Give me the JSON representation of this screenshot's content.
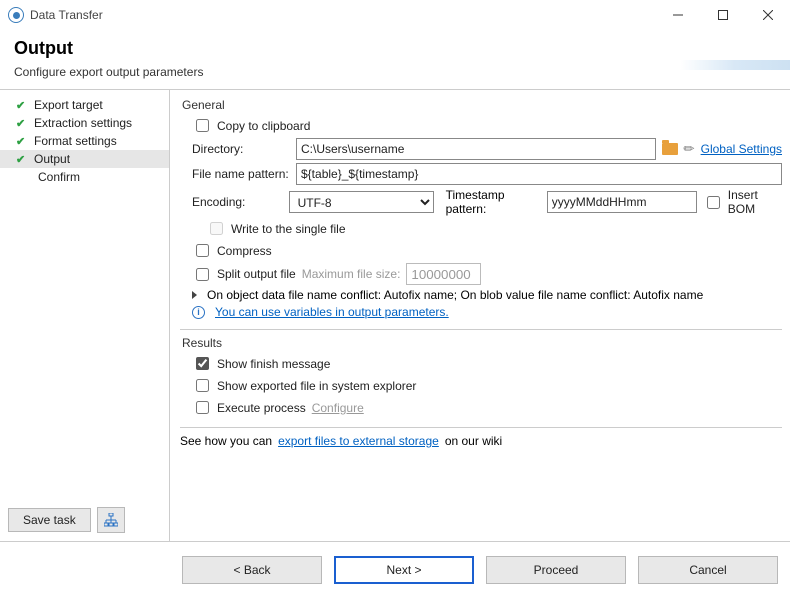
{
  "window": {
    "title": "Data Transfer"
  },
  "header": {
    "title": "Output",
    "subtitle": "Configure export output parameters"
  },
  "sidebar": {
    "steps": [
      {
        "label": "Export target",
        "done": true,
        "current": false
      },
      {
        "label": "Extraction settings",
        "done": true,
        "current": false
      },
      {
        "label": "Format settings",
        "done": true,
        "current": false
      },
      {
        "label": "Output",
        "done": true,
        "current": true
      },
      {
        "label": "Confirm",
        "done": false,
        "current": false
      }
    ],
    "save_task": "Save task"
  },
  "general": {
    "section": "General",
    "copy_to_clipboard": "Copy to clipboard",
    "directory_label": "Directory:",
    "directory_value": "C:\\Users\\username",
    "global_settings": "Global Settings",
    "file_name_pattern_label": "File name pattern:",
    "file_name_pattern_value": "${table}_${timestamp}",
    "encoding_label": "Encoding:",
    "encoding_value": "UTF-8",
    "timestamp_pattern_label": "Timestamp pattern:",
    "timestamp_pattern_value": "yyyyMMddHHmm",
    "insert_bom": "Insert BOM",
    "write_single_file": "Write to the single file",
    "compress": "Compress",
    "split_output_file": "Split output file",
    "max_file_size_label": "Maximum file size:",
    "max_file_size_value": "10000000",
    "conflict_line": "On object data file name conflict: Autofix name; On blob value file name conflict: Autofix name",
    "variables_hint": "You can use variables in output parameters."
  },
  "results": {
    "section": "Results",
    "show_finish_message": "Show finish message",
    "show_in_explorer": "Show exported file in system explorer",
    "execute_process": "Execute process",
    "configure": "Configure"
  },
  "wiki": {
    "prefix": "See how you can ",
    "link": "export files to external storage",
    "suffix": " on our wiki"
  },
  "footer": {
    "back": "< Back",
    "next": "Next >",
    "proceed": "Proceed",
    "cancel": "Cancel"
  }
}
